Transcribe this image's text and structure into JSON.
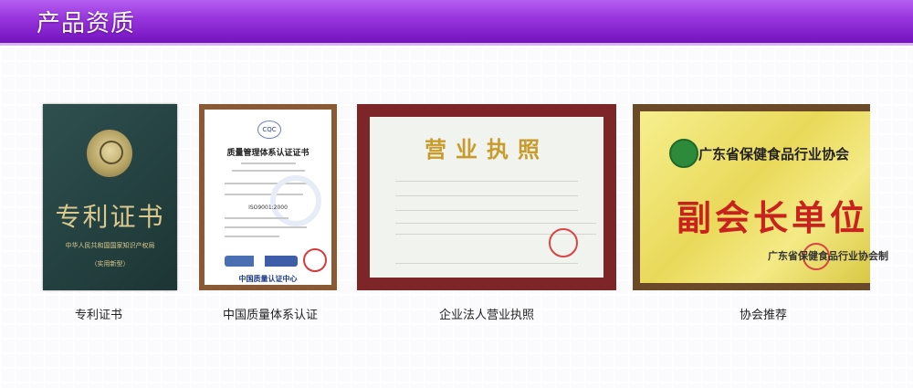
{
  "header": {
    "title": "产品资质"
  },
  "certificates": [
    {
      "caption": "专利证书",
      "heading": "专利证书",
      "issuer": "中华人民共和国国家知识产权局",
      "subtype": "（实用新型）"
    },
    {
      "caption": "中国质量体系认证",
      "logo": "CQC",
      "heading": "质量管理体系认证证书",
      "standard": "ISO9001:2000",
      "issuer": "中国质量认证中心"
    },
    {
      "caption": "企业法人营业执照",
      "heading": "营业执照"
    },
    {
      "caption": "协会推荐",
      "association": "广东省保健食品行业协会",
      "heading": "副会长单位",
      "footer": "广东省保健食品行业协会制"
    }
  ],
  "colors": {
    "header_top": "#b55ef0",
    "header_bottom": "#7414bf",
    "plaque_red": "#c9221e",
    "license_gold": "#c89b2c"
  }
}
